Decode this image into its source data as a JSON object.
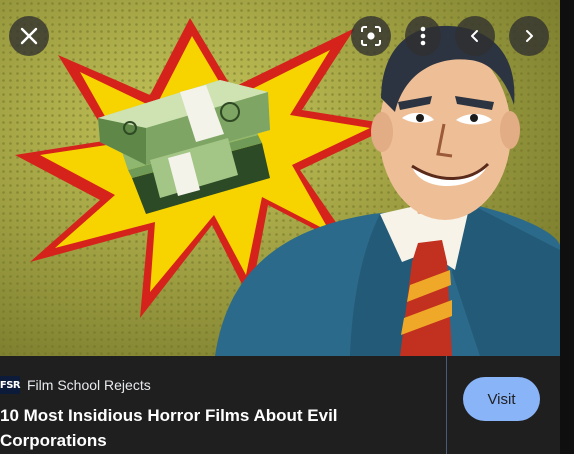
{
  "source": {
    "favicon_text": "FSR",
    "name": "Film School Rejects"
  },
  "result": {
    "title": "10 Most Insidious Horror Films About Evil Corporations"
  },
  "actions": {
    "visit_label": "Visit"
  },
  "controls": {
    "close": "close-icon",
    "lens": "lens-search-icon",
    "more": "more-vert-icon",
    "prev": "chevron-left-icon",
    "next": "chevron-right-icon"
  },
  "colors": {
    "panel_bg": "#1f1f1f",
    "accent": "#8ab4f8",
    "burst_yellow": "#f7d300",
    "burst_red": "#d5231b",
    "suit_blue": "#2b6a8a"
  }
}
